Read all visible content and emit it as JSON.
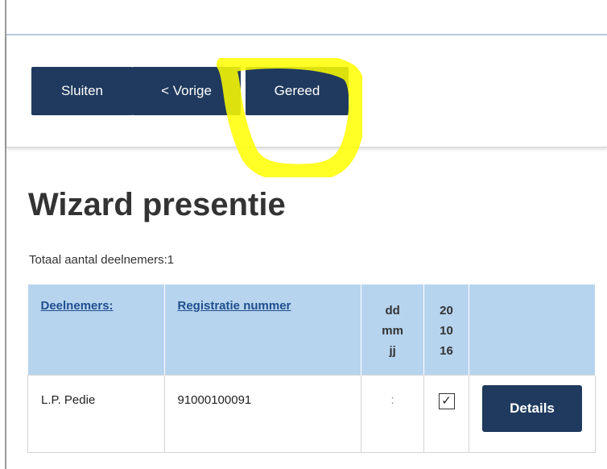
{
  "toolbar": {
    "close_label": "Sluiten",
    "prev_label": "< Vorige",
    "done_label": "Gereed",
    "highlight_color": "#ffff00"
  },
  "page": {
    "title": "Wizard presentie",
    "total_text": "Totaal aantal deelnemers:1"
  },
  "table": {
    "headers": {
      "participants": "Deelnemers:",
      "registration": "Registratie nummer",
      "date_format": [
        "dd",
        "mm",
        "jj"
      ],
      "date_value": [
        "20",
        "10",
        "16"
      ]
    },
    "rows": [
      {
        "name": "L.P. Pedie",
        "registration": "91000100091",
        "time": ":",
        "checked": "✓",
        "details_label": "Details"
      }
    ]
  },
  "colors": {
    "button_bg": "#1f3a5e",
    "header_bg": "#b7d4ef",
    "link": "#1f4e8c"
  }
}
